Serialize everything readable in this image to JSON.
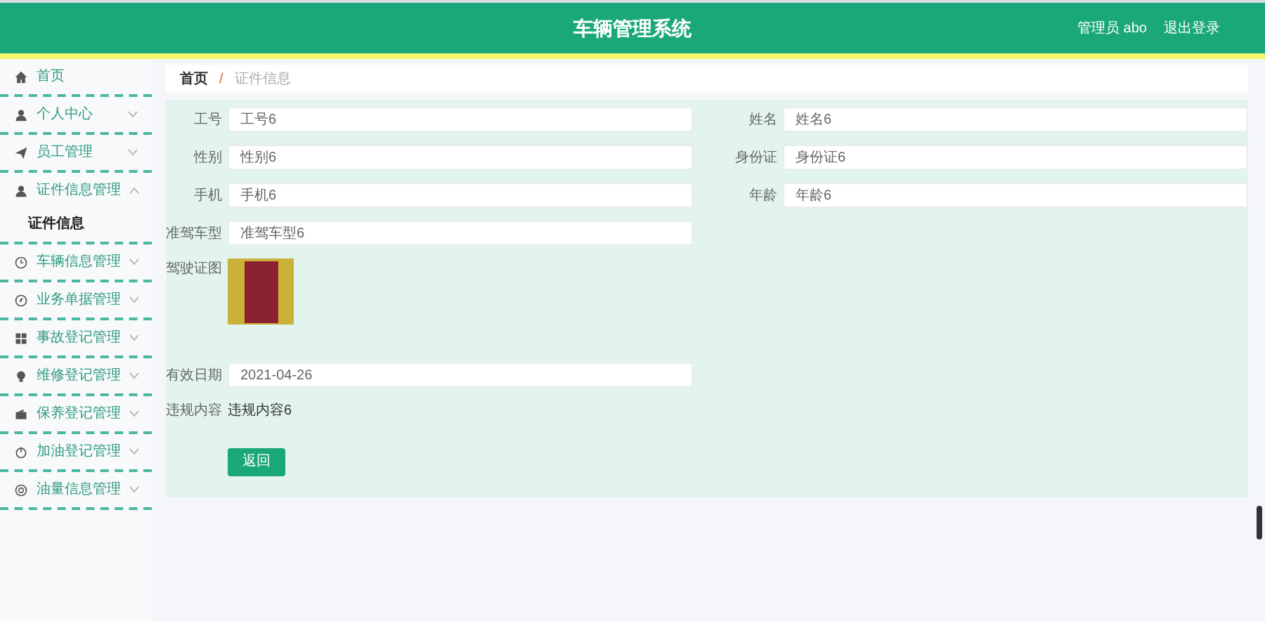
{
  "header": {
    "title": "车辆管理系统",
    "user": "管理员 abo",
    "logout": "退出登录"
  },
  "sidebar": {
    "items": [
      {
        "label": "首页",
        "expandable": false
      },
      {
        "label": "个人中心",
        "expandable": true,
        "expanded": false
      },
      {
        "label": "员工管理",
        "expandable": true,
        "expanded": false
      },
      {
        "label": "证件信息管理",
        "expandable": true,
        "expanded": true,
        "children": [
          {
            "label": "证件信息",
            "selected": true
          }
        ]
      },
      {
        "label": "车辆信息管理",
        "expandable": true,
        "expanded": false
      },
      {
        "label": "业务单据管理",
        "expandable": true,
        "expanded": false
      },
      {
        "label": "事故登记管理",
        "expandable": true,
        "expanded": false
      },
      {
        "label": "维修登记管理",
        "expandable": true,
        "expanded": false
      },
      {
        "label": "保养登记管理",
        "expandable": true,
        "expanded": false
      },
      {
        "label": "加油登记管理",
        "expandable": true,
        "expanded": false
      },
      {
        "label": "油量信息管理",
        "expandable": true,
        "expanded": false
      }
    ]
  },
  "breadcrumb": {
    "separator": "/",
    "items": [
      "首页",
      "证件信息"
    ]
  },
  "form": {
    "rows": [
      [
        {
          "kind": "input",
          "label": "工号",
          "value": "工号6"
        },
        {
          "kind": "input",
          "label": "姓名",
          "value": "姓名6"
        }
      ],
      [
        {
          "kind": "input",
          "label": "性别",
          "value": "性别6"
        },
        {
          "kind": "input",
          "label": "身份证",
          "value": "身份证6"
        }
      ],
      [
        {
          "kind": "input",
          "label": "手机",
          "value": "手机6"
        },
        {
          "kind": "input",
          "label": "年龄",
          "value": "年龄6"
        }
      ],
      [
        {
          "kind": "input",
          "label": "准驾车型",
          "value": "准驾车型6"
        }
      ],
      [
        {
          "kind": "image",
          "label": "驾驶证图"
        }
      ],
      [
        {
          "kind": "input",
          "label": "有效日期",
          "value": "2021-04-26"
        }
      ],
      [
        {
          "kind": "text",
          "label": "违规内容",
          "value": "违规内容6"
        }
      ]
    ],
    "button": "返回"
  }
}
